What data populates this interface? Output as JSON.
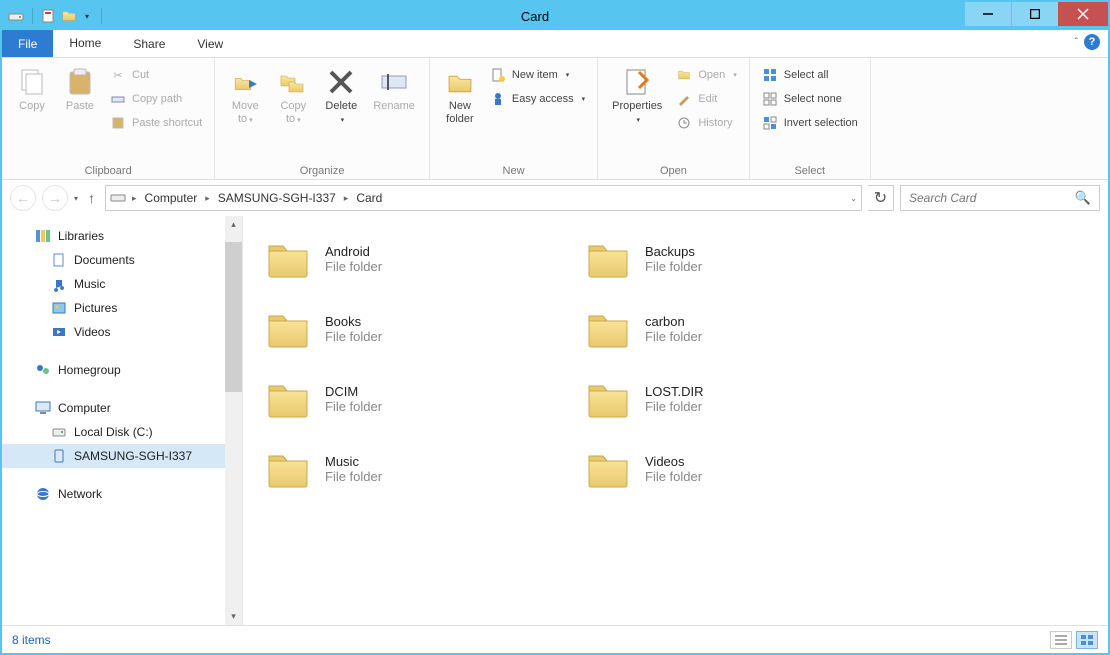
{
  "window": {
    "title": "Card"
  },
  "tabs": {
    "file": "File",
    "home": "Home",
    "share": "Share",
    "view": "View"
  },
  "ribbon": {
    "clipboard": {
      "label": "Clipboard",
      "copy": "Copy",
      "paste": "Paste",
      "cut": "Cut",
      "copy_path": "Copy path",
      "paste_shortcut": "Paste shortcut"
    },
    "organize": {
      "label": "Organize",
      "move_to": "Move\nto",
      "copy_to": "Copy\nto",
      "delete": "Delete",
      "rename": "Rename"
    },
    "new": {
      "label": "New",
      "new_folder": "New\nfolder",
      "new_item": "New item",
      "easy_access": "Easy access"
    },
    "open": {
      "label": "Open",
      "properties": "Properties",
      "open": "Open",
      "edit": "Edit",
      "history": "History"
    },
    "select": {
      "label": "Select",
      "select_all": "Select all",
      "select_none": "Select none",
      "invert": "Invert selection"
    }
  },
  "breadcrumb": [
    "Computer",
    "SAMSUNG-SGH-I337",
    "Card"
  ],
  "search": {
    "placeholder": "Search Card"
  },
  "tree": {
    "libraries": "Libraries",
    "lib_items": [
      "Documents",
      "Music",
      "Pictures",
      "Videos"
    ],
    "homegroup": "Homegroup",
    "computer": "Computer",
    "local_disk": "Local Disk (C:)",
    "device": "SAMSUNG-SGH-I337",
    "network": "Network"
  },
  "folders": [
    {
      "name": "Android",
      "type": "File folder"
    },
    {
      "name": "Backups",
      "type": "File folder"
    },
    {
      "name": "Books",
      "type": "File folder"
    },
    {
      "name": "carbon",
      "type": "File folder"
    },
    {
      "name": "DCIM",
      "type": "File folder"
    },
    {
      "name": "LOST.DIR",
      "type": "File folder"
    },
    {
      "name": "Music",
      "type": "File folder"
    },
    {
      "name": "Videos",
      "type": "File folder"
    }
  ],
  "status": {
    "count": "8 items"
  }
}
